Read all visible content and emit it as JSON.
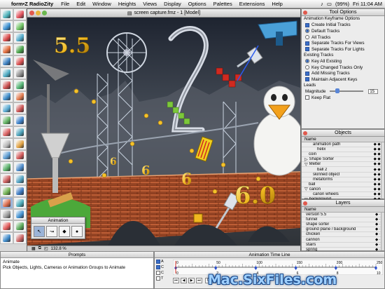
{
  "menubar": {
    "app_name": "form•Z RadioZity",
    "items": [
      "File",
      "Edit",
      "Window",
      "Heights",
      "Views",
      "Display",
      "Options",
      "Palettes",
      "Extensions",
      "Help"
    ],
    "battery": "(99%)",
    "clock": "Fri 11:04 AM"
  },
  "model_window": {
    "title": "screen capture.fmz - 1 [Model]",
    "zoom": "132.8 %",
    "scene_numbers": [
      "5.5",
      "6",
      "6",
      "6",
      "6.0"
    ]
  },
  "animation_palette": {
    "title": "Animation"
  },
  "tool_options": {
    "title": "Tool Options",
    "section_keyframe": "Animation Keyframe Options",
    "create_initial_tracks": "Create Initial Tracks",
    "default_tracks": "Default Tracks",
    "all_tracks": "All Tracks",
    "separate_tracks_views": "Separate Tracks For Views",
    "separate_tracks_lights": "Separate Tracks For Lights",
    "section_existing": "Existing Tracks",
    "key_all_existing": "Key All Existing",
    "key_changed_tracks": "Key Changed Tracks Only",
    "add_missing_tracks": "Add Missing Tracks",
    "maintain_adjacent_keys": "Maintain Adjacent Keys",
    "section_leads": "Leads",
    "magnitude_label": "Magnitude",
    "magnitude_value": "15",
    "keep_flat": "Keep Flat",
    "magnitude_fraction": 0.15
  },
  "objects": {
    "title": "Objects",
    "column_name": "Name",
    "items": [
      {
        "name": "animation path",
        "indent": 2
      },
      {
        "name": "helix",
        "indent": 3
      },
      {
        "name": "coin",
        "indent": 1
      },
      {
        "name": "Shape Sorter",
        "indent": 0,
        "expander": "▷"
      },
      {
        "name": "Melter",
        "indent": 0,
        "expander": "▽"
      },
      {
        "name": "ball 2",
        "indent": 3
      },
      {
        "name": "skinned object",
        "indent": 2
      },
      {
        "name": "metaforms",
        "indent": 2
      },
      {
        "name": "ball",
        "indent": 1
      },
      {
        "name": "canon",
        "indent": 0,
        "expander": "▽"
      },
      {
        "name": "canon wheels",
        "indent": 2
      },
      {
        "name": "background",
        "indent": 0,
        "expander": "▽"
      }
    ]
  },
  "layers": {
    "title": "Layers",
    "column_name": "Name",
    "items": [
      "version 5.5",
      "funnel",
      "shape sorter",
      "ground plane / background",
      "chicken",
      "cannon",
      "stairs",
      "spring",
      "ramps"
    ]
  },
  "prompts": {
    "title": "Prompts",
    "tool_name": "Animate",
    "message": "Pick Objects, Lights, Cameras or Animation Groups to Animate"
  },
  "timeline": {
    "title": "Animation Time Line",
    "tick_labels": [
      "0",
      "50",
      "100",
      "150",
      "200",
      "250"
    ],
    "current_frame": "0",
    "end_label": "10",
    "lower_tick_labels": [
      "0",
      "2",
      "4",
      "6",
      "8",
      "10"
    ],
    "side_labels": [
      "A",
      "C",
      "C",
      "T"
    ]
  },
  "watermark": "Mac.SixFiles.com",
  "colors": {
    "accent": "#3a6fc8",
    "selection": "#9bb4d8",
    "bridge": "#b5512e",
    "sky": "#3d4450"
  }
}
